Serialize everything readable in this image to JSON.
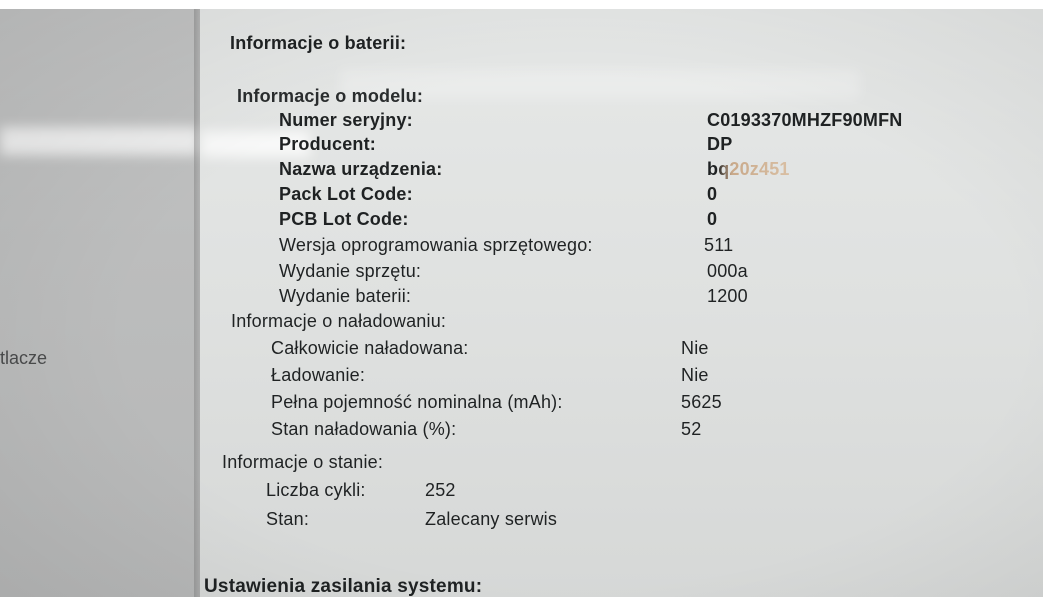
{
  "sidebar": {
    "partial_item": "tlacze"
  },
  "battery": {
    "title": "Informacje o baterii:",
    "model": {
      "heading": "Informacje o modelu:",
      "rows": [
        {
          "label": "Numer seryjny:",
          "value": "C0193370MHZF90MFN"
        },
        {
          "label": "Producent:",
          "value": "DP"
        },
        {
          "label": "Nazwa urządzenia:",
          "value": "bq20z451"
        },
        {
          "label": "Pack Lot Code:",
          "value": "0"
        },
        {
          "label": "PCB Lot Code:",
          "value": "0"
        },
        {
          "label": "Wersja oprogramowania sprzętowego:",
          "value": "511"
        },
        {
          "label": "Wydanie sprzętu:",
          "value": "000a"
        },
        {
          "label": "Wydanie baterii:",
          "value": "1200"
        }
      ]
    },
    "charge": {
      "heading": "Informacje o naładowaniu:",
      "rows": [
        {
          "label": "Całkowicie naładowana:",
          "value": "Nie"
        },
        {
          "label": "Ładowanie:",
          "value": "Nie"
        },
        {
          "label": "Pełna pojemność nominalna (mAh):",
          "value": "5625"
        },
        {
          "label": "Stan naładowania (%):",
          "value": "52"
        }
      ]
    },
    "health": {
      "heading": "Informacje o stanie:",
      "rows": [
        {
          "label": "Liczba cykli:",
          "value": "252"
        },
        {
          "label": "Stan:",
          "value": "Zalecany serwis"
        }
      ]
    }
  },
  "power": {
    "title": "Ustawienia zasilania systemu:"
  }
}
